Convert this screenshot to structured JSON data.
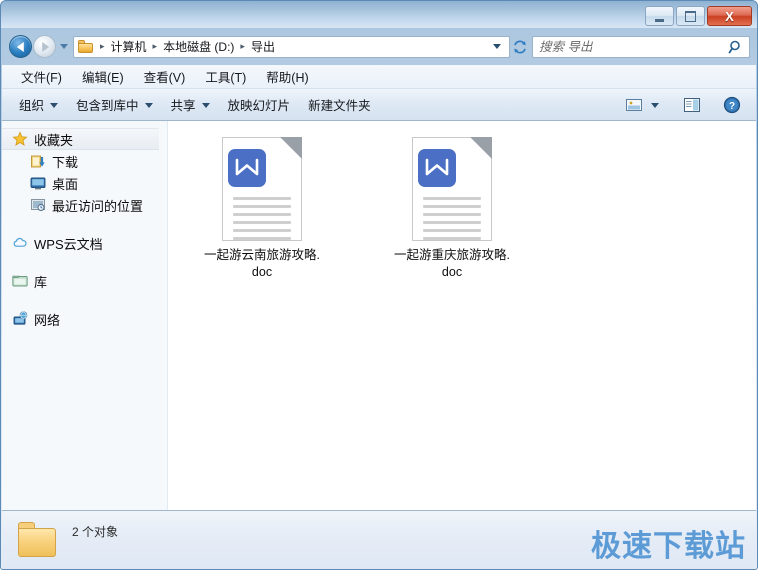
{
  "window": {
    "controls": {
      "minimize_label": "—",
      "maximize_label": "",
      "close_label": "X"
    }
  },
  "nav": {
    "back_tooltip": "后退",
    "forward_tooltip": "前进",
    "history_tooltip": "最近浏览的位置",
    "refresh_tooltip": "刷新",
    "breadcrumb": [
      "计算机",
      "本地磁盘 (D:)",
      "导出"
    ],
    "separator": "▸"
  },
  "search": {
    "placeholder": "搜索 导出",
    "value": ""
  },
  "menubar": {
    "items": [
      {
        "label": "文件(F)"
      },
      {
        "label": "编辑(E)"
      },
      {
        "label": "查看(V)"
      },
      {
        "label": "工具(T)"
      },
      {
        "label": "帮助(H)"
      }
    ]
  },
  "toolbar": {
    "items": [
      {
        "label": "组织",
        "caret": true
      },
      {
        "label": "包含到库中",
        "caret": true
      },
      {
        "label": "共享",
        "caret": true
      },
      {
        "label": "放映幻灯片",
        "caret": false
      },
      {
        "label": "新建文件夹",
        "caret": false
      }
    ],
    "view_icon": "view-mode-icon",
    "view_caret": "chevron-down-icon",
    "preview_icon": "preview-pane-icon",
    "help_icon": "help-icon"
  },
  "sidebar": {
    "favorites": {
      "label": "收藏夹",
      "icon": "star-icon",
      "children": [
        {
          "label": "下载",
          "icon": "downloads-icon"
        },
        {
          "label": "桌面",
          "icon": "desktop-icon"
        },
        {
          "label": "最近访问的位置",
          "icon": "recent-places-icon"
        }
      ]
    },
    "wps": {
      "label": "WPS云文档",
      "icon": "cloud-icon"
    },
    "library": {
      "label": "库",
      "icon": "library-icon"
    },
    "network": {
      "label": "网络",
      "icon": "network-icon"
    }
  },
  "files": [
    {
      "name": "一起游云南旅游攻略.doc",
      "icon": "wps-writer-doc-icon"
    },
    {
      "name": "一起游重庆旅游攻略.doc",
      "icon": "wps-writer-doc-icon"
    }
  ],
  "statusbar": {
    "folder_icon": "folder-icon",
    "item_count": "2 个对象",
    "watermark": "极速下载站"
  },
  "colors": {
    "title_blue": "#a9c5de",
    "close_red": "#cb3f22",
    "wps_badge_blue": "#4a6fc4",
    "watermark_blue": "#5c9bd6",
    "toolbar_blue": "#dfe9f5"
  }
}
